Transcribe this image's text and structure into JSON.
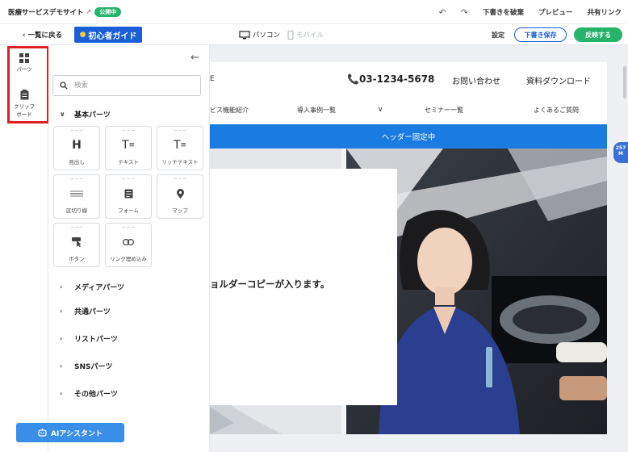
{
  "topbar": {
    "site_title": "医療サービスデモサイト",
    "publish_badge": "公開中",
    "discard_draft": "下書きを破棄",
    "preview": "プレビュー",
    "share_link": "共有リンク"
  },
  "subbar": {
    "back": "一覧に戻る",
    "guide": "初心者ガイド",
    "device_pc": "パソコン",
    "device_mobile": "モバイル",
    "settings": "設定",
    "save_draft": "下書き保存",
    "apply": "反映する"
  },
  "rail": {
    "parts": "パーツ",
    "clipboard_line1": "クリップ",
    "clipboard_line2": "ボード"
  },
  "panel": {
    "search_placeholder": "検索",
    "basic_parts": "基本パーツ",
    "tiles": [
      {
        "label": "見出し",
        "icon": "heading-icon"
      },
      {
        "label": "テキスト",
        "icon": "text-icon"
      },
      {
        "label": "リッチテキスト",
        "icon": "rich-text-icon"
      },
      {
        "label": "区切り線",
        "icon": "divider-icon"
      },
      {
        "label": "フォーム",
        "icon": "form-icon"
      },
      {
        "label": "マップ",
        "icon": "map-pin-icon"
      },
      {
        "label": "ボタン",
        "icon": "button-click-icon"
      },
      {
        "label": "リンク埋め込み",
        "icon": "link-icon"
      }
    ],
    "sections": [
      "メディアパーツ",
      "共通パーツ",
      "リストパーツ",
      "SNSパーツ",
      "その他パーツ"
    ],
    "ai_assistant": "AIアシスタント"
  },
  "preview": {
    "logo_fragment": "E",
    "phone": "03-1234-5678",
    "contact": "お問い合わせ",
    "download": "資料ダウンロード",
    "nav": [
      "ビス機能紹介",
      "導入事例一覧",
      "セミナー一覧",
      "よくあるご質問"
    ],
    "header_fixed": "ヘッダー固定中",
    "hero_copy": "ョルダーコピーが入ります。"
  },
  "side_tag": {
    "line1": "257",
    "line2": "M"
  },
  "colors": {
    "primary": "#1a5fd6",
    "green": "#27b36a",
    "header_band": "#1a7be0",
    "highlight": "#e02020"
  }
}
